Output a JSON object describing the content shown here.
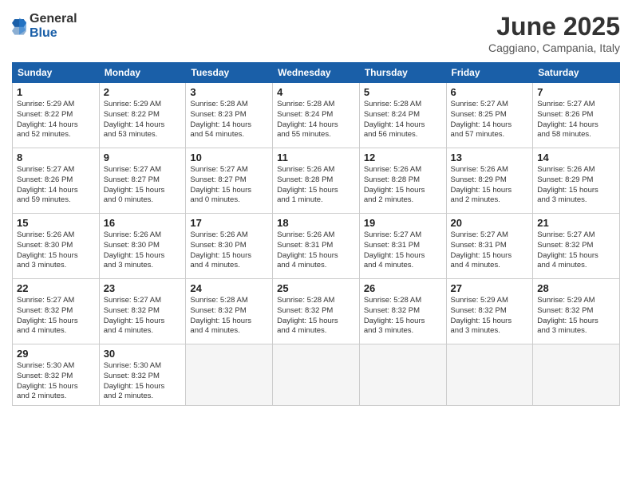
{
  "logo": {
    "general": "General",
    "blue": "Blue"
  },
  "title": "June 2025",
  "location": "Caggiano, Campania, Italy",
  "headers": [
    "Sunday",
    "Monday",
    "Tuesday",
    "Wednesday",
    "Thursday",
    "Friday",
    "Saturday"
  ],
  "weeks": [
    [
      {
        "day": "1",
        "info": "Sunrise: 5:29 AM\nSunset: 8:22 PM\nDaylight: 14 hours\nand 52 minutes."
      },
      {
        "day": "2",
        "info": "Sunrise: 5:29 AM\nSunset: 8:22 PM\nDaylight: 14 hours\nand 53 minutes."
      },
      {
        "day": "3",
        "info": "Sunrise: 5:28 AM\nSunset: 8:23 PM\nDaylight: 14 hours\nand 54 minutes."
      },
      {
        "day": "4",
        "info": "Sunrise: 5:28 AM\nSunset: 8:24 PM\nDaylight: 14 hours\nand 55 minutes."
      },
      {
        "day": "5",
        "info": "Sunrise: 5:28 AM\nSunset: 8:24 PM\nDaylight: 14 hours\nand 56 minutes."
      },
      {
        "day": "6",
        "info": "Sunrise: 5:27 AM\nSunset: 8:25 PM\nDaylight: 14 hours\nand 57 minutes."
      },
      {
        "day": "7",
        "info": "Sunrise: 5:27 AM\nSunset: 8:26 PM\nDaylight: 14 hours\nand 58 minutes."
      }
    ],
    [
      {
        "day": "8",
        "info": "Sunrise: 5:27 AM\nSunset: 8:26 PM\nDaylight: 14 hours\nand 59 minutes."
      },
      {
        "day": "9",
        "info": "Sunrise: 5:27 AM\nSunset: 8:27 PM\nDaylight: 15 hours\nand 0 minutes."
      },
      {
        "day": "10",
        "info": "Sunrise: 5:27 AM\nSunset: 8:27 PM\nDaylight: 15 hours\nand 0 minutes."
      },
      {
        "day": "11",
        "info": "Sunrise: 5:26 AM\nSunset: 8:28 PM\nDaylight: 15 hours\nand 1 minute."
      },
      {
        "day": "12",
        "info": "Sunrise: 5:26 AM\nSunset: 8:28 PM\nDaylight: 15 hours\nand 2 minutes."
      },
      {
        "day": "13",
        "info": "Sunrise: 5:26 AM\nSunset: 8:29 PM\nDaylight: 15 hours\nand 2 minutes."
      },
      {
        "day": "14",
        "info": "Sunrise: 5:26 AM\nSunset: 8:29 PM\nDaylight: 15 hours\nand 3 minutes."
      }
    ],
    [
      {
        "day": "15",
        "info": "Sunrise: 5:26 AM\nSunset: 8:30 PM\nDaylight: 15 hours\nand 3 minutes."
      },
      {
        "day": "16",
        "info": "Sunrise: 5:26 AM\nSunset: 8:30 PM\nDaylight: 15 hours\nand 3 minutes."
      },
      {
        "day": "17",
        "info": "Sunrise: 5:26 AM\nSunset: 8:30 PM\nDaylight: 15 hours\nand 4 minutes."
      },
      {
        "day": "18",
        "info": "Sunrise: 5:26 AM\nSunset: 8:31 PM\nDaylight: 15 hours\nand 4 minutes."
      },
      {
        "day": "19",
        "info": "Sunrise: 5:27 AM\nSunset: 8:31 PM\nDaylight: 15 hours\nand 4 minutes."
      },
      {
        "day": "20",
        "info": "Sunrise: 5:27 AM\nSunset: 8:31 PM\nDaylight: 15 hours\nand 4 minutes."
      },
      {
        "day": "21",
        "info": "Sunrise: 5:27 AM\nSunset: 8:32 PM\nDaylight: 15 hours\nand 4 minutes."
      }
    ],
    [
      {
        "day": "22",
        "info": "Sunrise: 5:27 AM\nSunset: 8:32 PM\nDaylight: 15 hours\nand 4 minutes."
      },
      {
        "day": "23",
        "info": "Sunrise: 5:27 AM\nSunset: 8:32 PM\nDaylight: 15 hours\nand 4 minutes."
      },
      {
        "day": "24",
        "info": "Sunrise: 5:28 AM\nSunset: 8:32 PM\nDaylight: 15 hours\nand 4 minutes."
      },
      {
        "day": "25",
        "info": "Sunrise: 5:28 AM\nSunset: 8:32 PM\nDaylight: 15 hours\nand 4 minutes."
      },
      {
        "day": "26",
        "info": "Sunrise: 5:28 AM\nSunset: 8:32 PM\nDaylight: 15 hours\nand 3 minutes."
      },
      {
        "day": "27",
        "info": "Sunrise: 5:29 AM\nSunset: 8:32 PM\nDaylight: 15 hours\nand 3 minutes."
      },
      {
        "day": "28",
        "info": "Sunrise: 5:29 AM\nSunset: 8:32 PM\nDaylight: 15 hours\nand 3 minutes."
      }
    ],
    [
      {
        "day": "29",
        "info": "Sunrise: 5:30 AM\nSunset: 8:32 PM\nDaylight: 15 hours\nand 2 minutes."
      },
      {
        "day": "30",
        "info": "Sunrise: 5:30 AM\nSunset: 8:32 PM\nDaylight: 15 hours\nand 2 minutes."
      },
      {
        "day": "",
        "info": ""
      },
      {
        "day": "",
        "info": ""
      },
      {
        "day": "",
        "info": ""
      },
      {
        "day": "",
        "info": ""
      },
      {
        "day": "",
        "info": ""
      }
    ]
  ]
}
